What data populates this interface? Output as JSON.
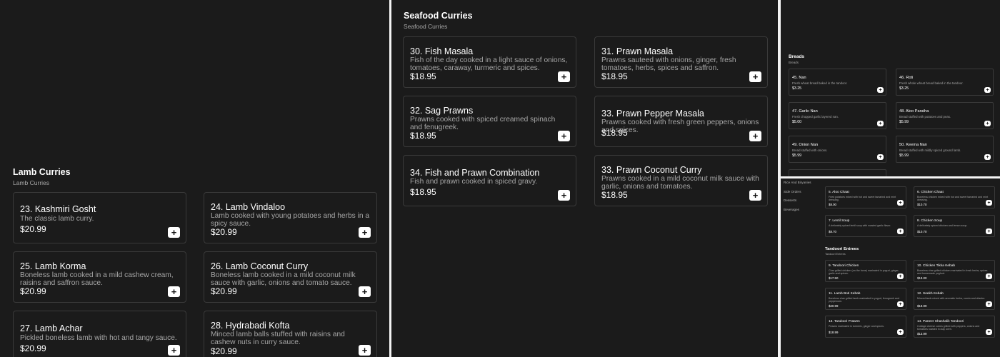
{
  "lamb": {
    "title": "Lamb Curries",
    "subtitle": "Lamb Curries",
    "items": [
      {
        "name": "23. Kashmiri Gosht",
        "desc": "The classic lamb curry.",
        "price": "$20.99"
      },
      {
        "name": "24. Lamb Vindaloo",
        "desc": "Lamb cooked with young potatoes and herbs in a spicy sauce.",
        "price": "$20.99"
      },
      {
        "name": "25. Lamb Korma",
        "desc": "Boneless lamb cooked in a mild cashew cream, raisins and saffron sauce.",
        "price": "$20.99"
      },
      {
        "name": "26. Lamb Coconut Curry",
        "desc": "Boneless lamb cooked in a mild coconut milk sauce with garlic, onions and tomato sauce.",
        "price": "$20.99"
      },
      {
        "name": "27. Lamb Achar",
        "desc": "Pickled boneless lamb with hot and tangy sauce.",
        "price": "$20.99"
      },
      {
        "name": "28. Hydrabadi Kofta",
        "desc": "Minced lamb balls stuffed with raisins and cashew nuts in curry sauce.",
        "price": "$20.99"
      }
    ]
  },
  "seafood": {
    "title": "Seafood Curries",
    "subtitle": "Seafood Curries",
    "items": [
      {
        "name": "30. Fish Masala",
        "desc": "Fish of the day cooked in a light sauce of onions, tomatoes, caraway, turmeric and spices.",
        "price": "$18.95"
      },
      {
        "name": "31. Prawn Masala",
        "desc": "Prawns sauteed with onions, ginger, fresh tomatoes, herbs, spices and saffron.",
        "price": "$18.95"
      },
      {
        "name": "32. Sag Prawns",
        "desc": "Prawns cooked with spiced creamed spinach and fenugreek.",
        "price": "$18.95"
      },
      {
        "name": "33. Prawn Pepper Masala",
        "desc": "Prawns cooked with fresh green peppers, onions and spices.",
        "price": "$18.95"
      },
      {
        "name": "34. Fish and Prawn Combination",
        "desc": "Fish and prawn cooked in spiced gravy.",
        "price": "$18.95"
      },
      {
        "name": "33. Prawn Coconut Curry",
        "desc": "Prawns cooked in a mild coconut milk sauce with garlic, onions and tomatoes.",
        "price": "$18.95"
      }
    ]
  },
  "breads": {
    "title": "Breads",
    "subtitle": "Breads",
    "items": [
      {
        "name": "45. Nan",
        "desc": "Fresh wheat bread baked in the tandoor.",
        "price": "$3.25"
      },
      {
        "name": "46. Roti",
        "desc": "Fresh whole wheat bread baked in the tandoor.",
        "price": "$3.25"
      },
      {
        "name": "47. Garlic Nan",
        "desc": "Fresh chopped garlic layered nan.",
        "price": "$5.00"
      },
      {
        "name": "48. Aloo Paratha",
        "desc": "Bread stuffed with potatoes and peas.",
        "price": "$5.99"
      },
      {
        "name": "49. Onion Nan",
        "desc": "Bread stuffed with onions.",
        "price": "$5.99"
      },
      {
        "name": "50. Keema Nan",
        "desc": "Bread stuffed with mildly spiced ground lamb.",
        "price": "$5.99"
      }
    ]
  },
  "sidebar": {
    "links": [
      "Rice And Biryanies",
      "Side Orders",
      "Desserts",
      "Beverages"
    ]
  },
  "appetizers": {
    "items": [
      {
        "name": "5. Aloo Chaat",
        "desc": "Fried potatoes mixed with hot and sweet tamarind and mint dressing.",
        "price": "$8.00"
      },
      {
        "name": "6. Chicken Chaat",
        "desc": "Boneless chicken mixed with hot and sweet tamarind and mint dressing.",
        "price": "$10.70"
      },
      {
        "name": "7. Lentil Soup",
        "desc": "A delicately spiced lentil soup with roasted garlic flavor.",
        "price": "$8.70"
      },
      {
        "name": "8. Chicken Soup",
        "desc": "A delicately spiced chicken and lemon soup.",
        "price": "$10.70"
      }
    ]
  },
  "tandoori": {
    "title": "Tandoori Entrees",
    "subtitle": "Tandoori Entrees",
    "items": [
      {
        "name": "9. Tandoori Chicken",
        "desc": "Char grilled chicken (on the bone) marinated in yogurt, ginger, garlic and spices.",
        "price": "$17.50"
      },
      {
        "name": "10. Chicken Tikka Kebab",
        "desc": "Boneless char grilled chicken marinated in fresh herbs, spices and homemade yoghurt.",
        "price": "$19.00"
      },
      {
        "name": "11. Lamb Boti Kebab",
        "desc": "Boneless char grilled lamb marinated in yogurt, fenugreek and peppercorn.",
        "price": "$20.99"
      },
      {
        "name": "12. Seekh Kebab",
        "desc": "Minced lamb mixed with aromatic herbs, cumin and cilantro.",
        "price": "$18.99"
      },
      {
        "name": "13. Tandoori Prawns",
        "desc": "Prawns marinated in turmeric, ginger and spices.",
        "price": "$18.99"
      },
      {
        "name": "14. Paneer Shashalik Tandoori",
        "desc": "Cottage cheese cubes grilled with peppers, onions and tomatoes roasted in clay oven.",
        "price": "$13.99"
      }
    ]
  },
  "add_label": "+"
}
